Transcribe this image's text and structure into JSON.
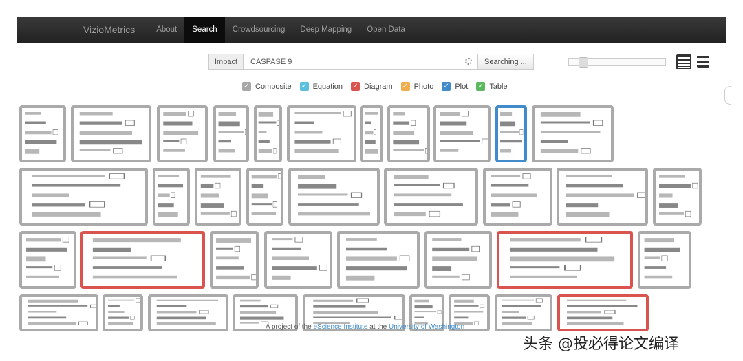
{
  "navbar": {
    "brand": "VizioMetrics",
    "items": [
      {
        "label": "About",
        "active": false
      },
      {
        "label": "Search",
        "active": true
      },
      {
        "label": "Crowdsourcing",
        "active": false
      },
      {
        "label": "Deep Mapping",
        "active": false
      },
      {
        "label": "Open Data",
        "active": false
      }
    ]
  },
  "search": {
    "sort_label": "Impact",
    "query": "CASPASE 9",
    "button_label": "Searching ...",
    "loading_icon": "spinner-icon"
  },
  "zoom_slider": {
    "value_fraction": 0.12
  },
  "view_toggles": {
    "grid": "grid-view-icon",
    "list": "list-view-icon"
  },
  "filters": [
    {
      "label": "Composite",
      "checked": true,
      "color": "#a8a8a8"
    },
    {
      "label": "Equation",
      "checked": true,
      "color": "#5bc0de"
    },
    {
      "label": "Diagram",
      "checked": true,
      "color": "#d9534f"
    },
    {
      "label": "Photo",
      "checked": true,
      "color": "#f0ad4e"
    },
    {
      "label": "Plot",
      "checked": true,
      "color": "#428bca"
    },
    {
      "label": "Table",
      "checked": true,
      "color": "#5cb85c"
    }
  ],
  "results": {
    "border_colors": {
      "composite": "#aaaaaa",
      "diagram": "#d9534f",
      "plot": "#428bca"
    }
  },
  "footer": {
    "prefix": "A project of the ",
    "link1": "eScience Institute",
    "middle": " at the ",
    "link2": "University of Washington"
  },
  "watermark": "头条 @投必得论文编译"
}
